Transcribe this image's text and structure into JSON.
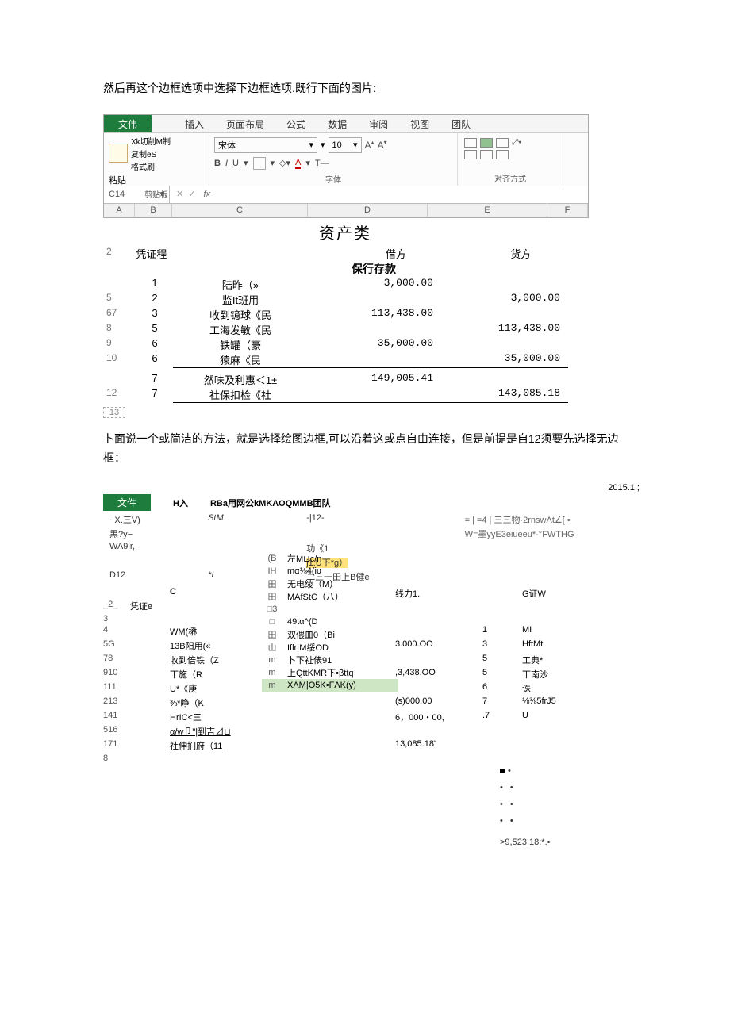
{
  "intro1": "然后再这个边框选项中选择下边框选项.既行下面的图片:",
  "ribbon": {
    "tabs": [
      "文伟",
      "",
      "插入",
      "页面布局",
      "公式",
      "数据",
      "审阅",
      "视图",
      "团队"
    ],
    "clip": {
      "cut": "Xk切削M制",
      "copy": "复制eS",
      "brush": "格式刷",
      "paste": "粘贴",
      "group": "剪贴板"
    },
    "font": {
      "name": "宋体",
      "size": "10",
      "b": "B",
      "i": "I",
      "u": "U",
      "group": "字体"
    },
    "align": {
      "t": "T—",
      "group": "对齐方式"
    }
  },
  "formula": {
    "name": "C14",
    "fx": "fx"
  },
  "cols": {
    "A": "A",
    "B": "B",
    "C": "C",
    "D": "D",
    "E": "E",
    "F": "F"
  },
  "sheet": {
    "title": "资产类",
    "r2": {
      "rn": "2",
      "b": "",
      "pz": "凭证程",
      "jf": "借方",
      "df": "货方"
    },
    "bank": "保行存款",
    "rows": [
      {
        "rn": "",
        "b": "1",
        "c": "陆昨（»",
        "d": "3,000.00",
        "e": ""
      },
      {
        "rn": "5",
        "b": "2",
        "c": "监It班用",
        "d": "",
        "e": "3,000.00"
      },
      {
        "rn": "67",
        "b": "3",
        "c": "收到镱球《民",
        "d": "113,438.00",
        "e": ""
      },
      {
        "rn": "8",
        "b": "5",
        "c": "工海发敏《民",
        "d": "",
        "e": "113,438.00"
      },
      {
        "rn": "9",
        "b": "6",
        "c": "铁罐（豪",
        "d": "35,000.00",
        "e": ""
      },
      {
        "rn": "10",
        "b": "6",
        "c": "猿麻《民",
        "d": "",
        "e": "35,000.00"
      }
    ],
    "rows2": [
      {
        "rn": "",
        "b": "7",
        "c": "然味及利惠＜1±",
        "d": "149,005.41",
        "e": ""
      },
      {
        "rn": "12",
        "b": "7",
        "c": "社保扣检《社",
        "d": "",
        "e": "143,085.18"
      }
    ],
    "r13": "13"
  },
  "intro2": "卜面说一个或简洁的方法，就是选择绘图边框,可以沿着这或点自由连接，但是前提是自12须要先选择无边框：",
  "fig2": {
    "date": "2015.1 ;",
    "tabs": {
      "file": "文件",
      "ins": "H入",
      "team": "RBa用网公kMKAOQMMB团队"
    },
    "lines": [
      {
        "c1": "−X.三V)",
        "c2": "StM",
        "c3": "-|12-",
        "c4": "= | =4 | 三三物·2rnswΛt∠[ •"
      },
      {
        "c1": "黑?y−",
        "c2": "",
        "c3": "",
        "c4": "W=墨yyE3eiueeu*·°FWTHG"
      },
      {
        "c1": "WA9lr,",
        "c2": "",
        "c3": "功《1",
        "c4": ""
      },
      {
        "c1": "",
        "c2": "",
        "c3": "j1.U下*g）",
        "c4": ""
      },
      {
        "c1": "D12",
        "c2": "*I",
        "c3": "二三一田上B健e",
        "c4": ""
      }
    ],
    "menu": [
      {
        "i": "(B",
        "t": "左M⊔c/n"
      },
      {
        "i": "IH",
        "t": "mα⅛4(iυ"
      },
      {
        "i": "田",
        "t": "无电绫（M）"
      },
      {
        "i": "田",
        "t": "MAfStC（八）"
      },
      {
        "i": "□3",
        "t": ""
      },
      {
        "i": "□",
        "t": "49tα^(D"
      },
      {
        "i": "田",
        "t": "双偎皿0（Bi"
      },
      {
        "i": "山",
        "t": "IflrtM绥OD"
      },
      {
        "i": "m",
        "t": "卜下祉俵91"
      },
      {
        "i": "m",
        "t": "上QttKMR下•βttq"
      },
      {
        "i": "m",
        "t": "XΛM|O5K•FΛK(y)"
      }
    ],
    "grid_heads": {
      "c": "C",
      "xl": "线力1.",
      "gz": "G证W"
    },
    "grid": [
      {
        "rn": "_2_",
        "b": "凭证e",
        "c": "",
        "i": "",
        "m": "",
        "d": "",
        "e": "",
        "f": ""
      },
      {
        "rn": "3",
        "b": "",
        "c": "",
        "i": "",
        "m": "",
        "d": "",
        "e": "",
        "f": ""
      },
      {
        "rn": "4",
        "b": "",
        "c": "WM(楙",
        "i": "",
        "m": "",
        "d": "",
        "e": "1",
        "f": "MI"
      },
      {
        "rn": "5G",
        "b": "",
        "c": "13B阳用(«",
        "i": "",
        "m": "",
        "d": "3.000.OO",
        "e": "3",
        "f": "HftMt"
      },
      {
        "rn": "78",
        "b": "",
        "c": "收到倍铁（Z",
        "i": "",
        "m": "",
        "d": "",
        "e": "5",
        "f": "工典*"
      },
      {
        "rn": "910",
        "b": "",
        "c": "丅施（R",
        "i": "",
        "m": "",
        "d": ",3,438.OO",
        "e": "5",
        "f": "丅南沙"
      },
      {
        "rn": "111",
        "b": "",
        "c": "U*《庚",
        "i": "",
        "m": "",
        "d": "",
        "e": "6",
        "f": "诛:"
      },
      {
        "rn": "213",
        "b": "",
        "c": "⅜*睁（K",
        "i": "",
        "m": "",
        "d": "(s)000.00",
        "e": "7",
        "f": "⅛⅜5frJ5"
      },
      {
        "rn": "141",
        "b": "",
        "c": "HrIC<三",
        "i": "",
        "m": "",
        "d": "6，000・00,",
        "e": ".7",
        "f": "U"
      },
      {
        "rn": "516",
        "b": "",
        "c": "α/w卩\"|到吉⊿⊔",
        "i": "",
        "m": "",
        "d": "",
        "e": "",
        "f": ""
      },
      {
        "rn": "171",
        "b": "",
        "c": "社伸扪府（11",
        "i": "",
        "m": "",
        "d": "13,085.18'",
        "e": "",
        "f": ""
      },
      {
        "rn": "8",
        "b": "",
        "c": "",
        "i": "",
        "m": "",
        "d": "",
        "e": "",
        "f": ""
      }
    ],
    "total": ">9,523.18:*.•"
  }
}
